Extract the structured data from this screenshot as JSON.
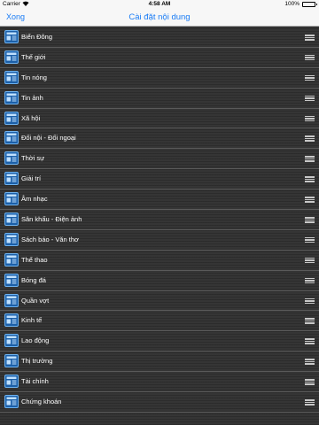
{
  "status_bar": {
    "carrier": "Carrier",
    "wifi_icon": "wifi-icon",
    "time": "4:58 AM",
    "battery": "100%",
    "battery_level": 1.0
  },
  "nav": {
    "done_label": "Xong",
    "title": "Cài đặt nội dung"
  },
  "row_icon": "newspaper-icon",
  "handle_icon": "reorder-handle-icon",
  "colors": {
    "accent": "#1a7cf5",
    "list_background": "#353535",
    "row_text": "#ffffff"
  },
  "categories": [
    {
      "label": "Biển Đông"
    },
    {
      "label": "Thế giới"
    },
    {
      "label": "Tin nóng"
    },
    {
      "label": "Tin ảnh"
    },
    {
      "label": "Xã hội"
    },
    {
      "label": "Đối nội - Đối ngoại"
    },
    {
      "label": "Thời sự"
    },
    {
      "label": "Giải trí"
    },
    {
      "label": "Âm nhạc"
    },
    {
      "label": "Sân khấu -  Điện ảnh"
    },
    {
      "label": "Sách báo - Văn thơ"
    },
    {
      "label": "Thể thao"
    },
    {
      "label": "Bóng đá"
    },
    {
      "label": "Quần vợt"
    },
    {
      "label": "Kinh tế"
    },
    {
      "label": "Lao động"
    },
    {
      "label": "Thị trường"
    },
    {
      "label": "Tài chính"
    },
    {
      "label": "Chứng khoán"
    }
  ]
}
